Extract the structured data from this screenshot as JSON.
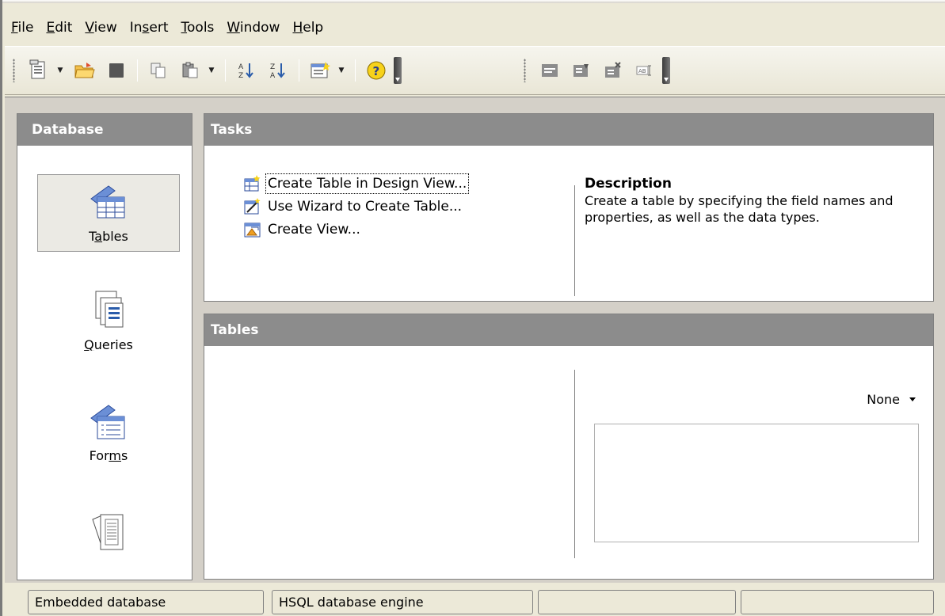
{
  "menu": [
    {
      "label": "File",
      "accel": "F"
    },
    {
      "label": "Edit",
      "accel": "E"
    },
    {
      "label": "View",
      "accel": "V"
    },
    {
      "label": "Insert",
      "accel": "s"
    },
    {
      "label": "Tools",
      "accel": "T"
    },
    {
      "label": "Window",
      "accel": "W"
    },
    {
      "label": "Help",
      "accel": "H"
    }
  ],
  "sidebar": {
    "header": "Database",
    "items": [
      {
        "label": "Tables",
        "selected": true
      },
      {
        "label": "Queries",
        "selected": false
      },
      {
        "label": "Forms",
        "selected": false
      },
      {
        "label": "",
        "selected": false
      }
    ]
  },
  "tasks": {
    "header": "Tasks",
    "items": [
      {
        "label": "Create Table in Design View...",
        "focused": true
      },
      {
        "label": "Use Wizard to Create Table...",
        "focused": false
      },
      {
        "label": "Create View...",
        "focused": false
      }
    ],
    "description_title": "Description",
    "description_text": "Create a table by specifying the field names and properties, as well as the data types."
  },
  "tables": {
    "header": "Tables",
    "preview_mode": "None"
  },
  "statusbar": [
    "Embedded database",
    "HSQL database engine",
    "",
    ""
  ],
  "colors": {
    "panel_header": "#8c8c8c",
    "background": "#d4d0c8",
    "chrome": "#ece9d8"
  }
}
